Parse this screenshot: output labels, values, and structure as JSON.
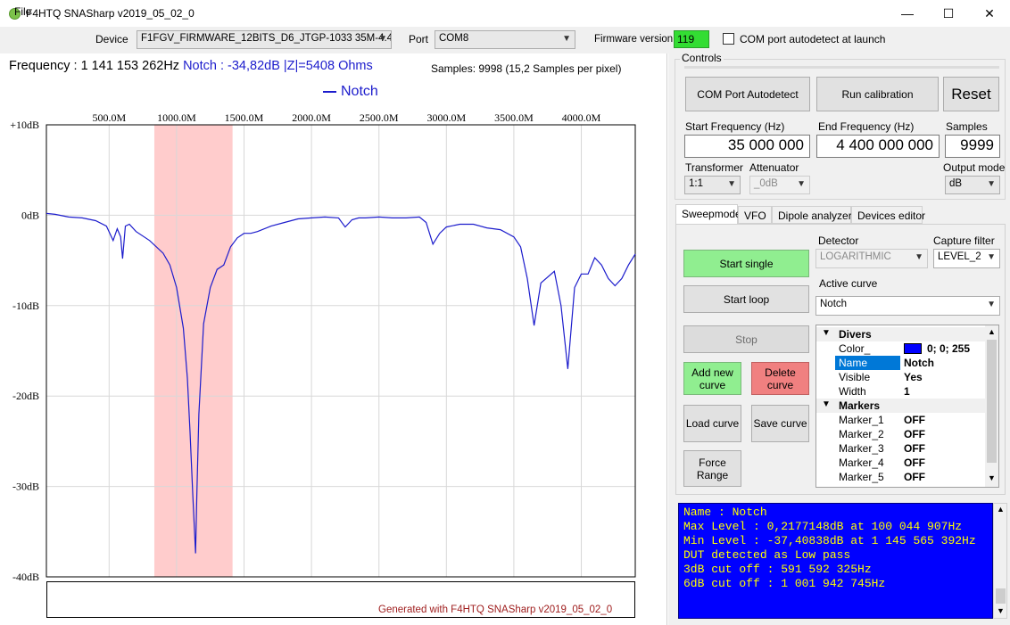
{
  "window": {
    "title": "F4HTQ SNASharp v2019_05_02_0",
    "minimize_glyph": "—",
    "maximize_glyph": "☐",
    "close_glyph": "✕"
  },
  "menu": {
    "file": "File"
  },
  "toolbar": {
    "device_label": "Device",
    "device_value": "F1FGV_FIRMWARE_12BITS_D6_JTGP-1033 35M-4.4",
    "port_label": "Port",
    "port_value": "COM8",
    "firmware_label": "Firmware version",
    "firmware_value": "119",
    "autodetect_label": "COM port autodetect at launch"
  },
  "chart_header": {
    "frequency": "Frequency : 1 141 153 262Hz",
    "notch": "Notch : -34,82dB  |Z|=5408 Ohms",
    "samples": "Samples: 9998 (15,2 Samples per pixel)",
    "legend": "Notch"
  },
  "chart_data": {
    "type": "line",
    "x_ticks": [
      "500.0M",
      "1000.0M",
      "1500.0M",
      "2000.0M",
      "2500.0M",
      "3000.0M",
      "3500.0M",
      "4000.0M"
    ],
    "y_ticks": [
      "+10dB",
      "0dB",
      "-10dB",
      "-20dB",
      "-30dB",
      "-40dB"
    ],
    "xlim": [
      35,
      4400
    ],
    "ylim": [
      -40,
      10
    ],
    "grid": true,
    "highlight_band": [
      835,
      1415
    ],
    "highlight_color": "#ffcccc",
    "series": [
      {
        "name": "Notch",
        "color": "#1c1ccc",
        "x": [
          35,
          100,
          200,
          300,
          400,
          480,
          530,
          560,
          585,
          600,
          620,
          650,
          700,
          800,
          900,
          950,
          1000,
          1050,
          1080,
          1100,
          1120,
          1141,
          1150,
          1165,
          1200,
          1250,
          1300,
          1350,
          1400,
          1450,
          1500,
          1550,
          1600,
          1700,
          1800,
          1900,
          2000,
          2100,
          2200,
          2250,
          2300,
          2350,
          2400,
          2500,
          2600,
          2700,
          2800,
          2850,
          2900,
          2950,
          3000,
          3100,
          3200,
          3300,
          3400,
          3500,
          3550,
          3600,
          3650,
          3700,
          3800,
          3850,
          3900,
          3950,
          4000,
          4050,
          4100,
          4150,
          4200,
          4250,
          4300,
          4350,
          4400
        ],
        "y": [
          0.2,
          0.1,
          -0.2,
          -0.3,
          -0.6,
          -1.2,
          -2.8,
          -1.5,
          -2.4,
          -4.8,
          -1.2,
          -1.0,
          -1.8,
          -2.8,
          -4.2,
          -5.5,
          -8.0,
          -12.5,
          -18.0,
          -24.0,
          -31.0,
          -37.4,
          -31.0,
          -22.0,
          -12.0,
          -8.0,
          -6.0,
          -5.5,
          -3.5,
          -2.5,
          -2.0,
          -2.0,
          -1.8,
          -1.2,
          -0.8,
          -0.4,
          -0.3,
          -0.2,
          -0.3,
          -1.3,
          -0.5,
          -0.3,
          -0.3,
          -0.2,
          -0.3,
          -0.3,
          -0.2,
          -0.8,
          -3.2,
          -2.0,
          -1.3,
          -1.0,
          -1.0,
          -1.4,
          -1.6,
          -2.4,
          -3.5,
          -7.0,
          -12.2,
          -7.5,
          -6.2,
          -10.0,
          -17.0,
          -8.0,
          -6.5,
          -6.5,
          -4.7,
          -5.5,
          -7.0,
          -7.8,
          -7.0,
          -5.5,
          -4.3
        ]
      }
    ]
  },
  "footer_text": "Generated with F4HTQ SNASharp v2019_05_02_0",
  "controls": {
    "group_label": "Controls",
    "autodetect_btn": "COM Port Autodetect",
    "calibration_btn": "Run calibration",
    "reset_btn": "Reset",
    "start_freq_label": "Start Frequency (Hz)",
    "start_freq_value": "35 000 000",
    "end_freq_label": "End Frequency (Hz)",
    "end_freq_value": "4 400 000 000",
    "samples_label": "Samples",
    "samples_value": "9999",
    "transformer_label": "Transformer",
    "transformer_value": "1:1",
    "attenuator_label": "Attenuator",
    "attenuator_value": "_0dB",
    "output_mode_label": "Output mode",
    "output_mode_value": "dB"
  },
  "tabs": [
    "Sweepmode",
    "VFO",
    "Dipole analyzer",
    "Devices editor"
  ],
  "sweep": {
    "start_single": "Start single",
    "start_loop": "Start loop",
    "stop": "Stop",
    "add_new_curve": "Add new curve",
    "delete_curve": "Delete curve",
    "load_curve": "Load curve",
    "save_curve": "Save curve",
    "force_range": "Force Range",
    "detector_label": "Detector",
    "detector_value": "LOGARITHMIC",
    "capture_filter_label": "Capture filter",
    "capture_filter_value": "LEVEL_2",
    "active_curve_label": "Active curve",
    "active_curve_value": "Notch"
  },
  "propgrid": {
    "divers_label": "Divers",
    "markers_label": "Markers",
    "color_swatch": "#0000ff",
    "rows_divers": [
      {
        "name": "Color_",
        "value": "0; 0; 255"
      },
      {
        "name": "Name",
        "value": "Notch"
      },
      {
        "name": "Visible",
        "value": "Yes"
      },
      {
        "name": "Width",
        "value": "1"
      }
    ],
    "rows_markers": [
      {
        "name": "Marker_1",
        "value": "OFF"
      },
      {
        "name": "Marker_2",
        "value": "OFF"
      },
      {
        "name": "Marker_3",
        "value": "OFF"
      },
      {
        "name": "Marker_4",
        "value": "OFF"
      },
      {
        "name": "Marker_5",
        "value": "OFF"
      }
    ]
  },
  "info": [
    "Name : Notch",
    "Max Level : 0,2177148dB at 100 044 907Hz",
    "Min Level : -37,40838dB at 1 145 565 392Hz",
    "DUT detected as Low pass",
    "3dB cut off : 591 592 325Hz",
    "6dB cut off : 1 001 942 745Hz"
  ]
}
